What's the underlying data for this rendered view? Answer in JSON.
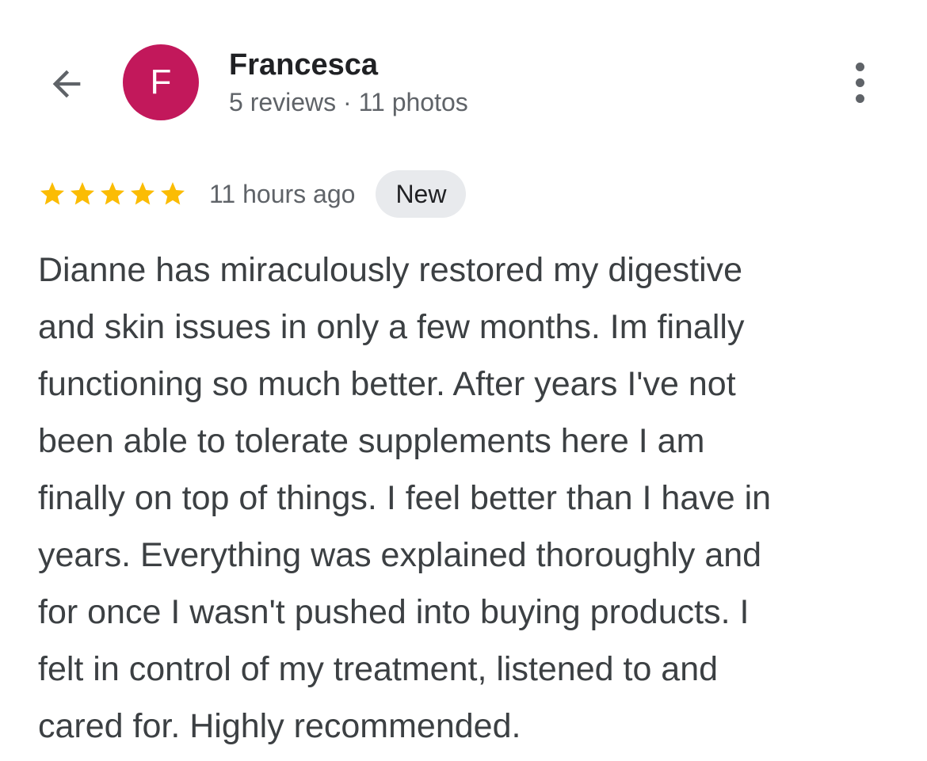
{
  "header": {
    "back_icon": "arrow-back-icon",
    "more_icon": "more-vert-icon"
  },
  "reviewer": {
    "initial": "F",
    "avatar_color": "#c2185b",
    "name": "Francesca",
    "stats": "5 reviews · 11 photos"
  },
  "review": {
    "rating": 5,
    "max_rating": 5,
    "star_color": "#fbbc04",
    "time_ago": "11 hours ago",
    "badge": "New",
    "lines": [
      "Dianne has miraculously restored my digestive",
      "and skin issues in only a few months. Im finally",
      "functioning so much better. After years I've not",
      "been able to tolerate supplements here I am",
      "finally on top of things. I feel better than I have in",
      "years. Everything was explained thoroughly and",
      "for once I wasn't pushed into buying products. I",
      "felt in control of my treatment, listened to and",
      "cared for. Highly recommended."
    ]
  }
}
